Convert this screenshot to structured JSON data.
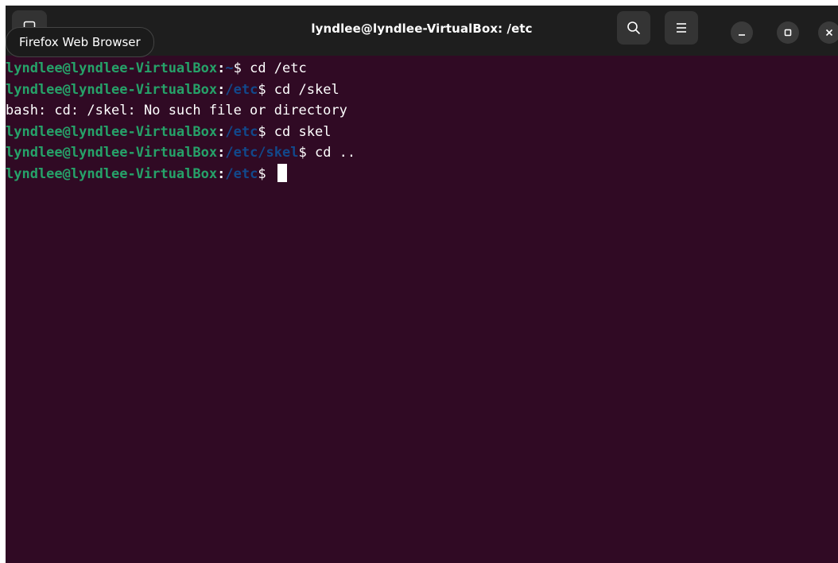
{
  "window": {
    "title": "lyndlee@lyndlee-VirtualBox: /etc",
    "tooltip": "Firefox Web Browser"
  },
  "icons": {
    "tab": "terminal-tab-icon",
    "search": "search-icon",
    "menu": "hamburger-menu-icon",
    "minimize": "minimize-icon",
    "maximize": "maximize-icon",
    "close": "close-icon"
  },
  "colors": {
    "background": "#300a24",
    "prompt_user": "#26a269",
    "prompt_path": "#12488b",
    "titlebar": "#1e1e1e"
  },
  "terminal": {
    "lines": [
      {
        "user": "lyndlee@lyndlee-VirtualBox",
        "sep": ":",
        "path": "~",
        "dollar": "$",
        "cmd": " cd /etc"
      },
      {
        "user": "lyndlee@lyndlee-VirtualBox",
        "sep": ":",
        "path": "/etc",
        "dollar": "$",
        "cmd": " cd /skel"
      },
      {
        "output": "bash: cd: /skel: No such file or directory"
      },
      {
        "user": "lyndlee@lyndlee-VirtualBox",
        "sep": ":",
        "path": "/etc",
        "dollar": "$",
        "cmd": " cd skel"
      },
      {
        "user": "lyndlee@lyndlee-VirtualBox",
        "sep": ":",
        "path": "/etc/skel",
        "dollar": "$",
        "cmd": " cd .."
      },
      {
        "user": "lyndlee@lyndlee-VirtualBox",
        "sep": ":",
        "path": "/etc",
        "dollar": "$",
        "cmd": " "
      }
    ]
  }
}
